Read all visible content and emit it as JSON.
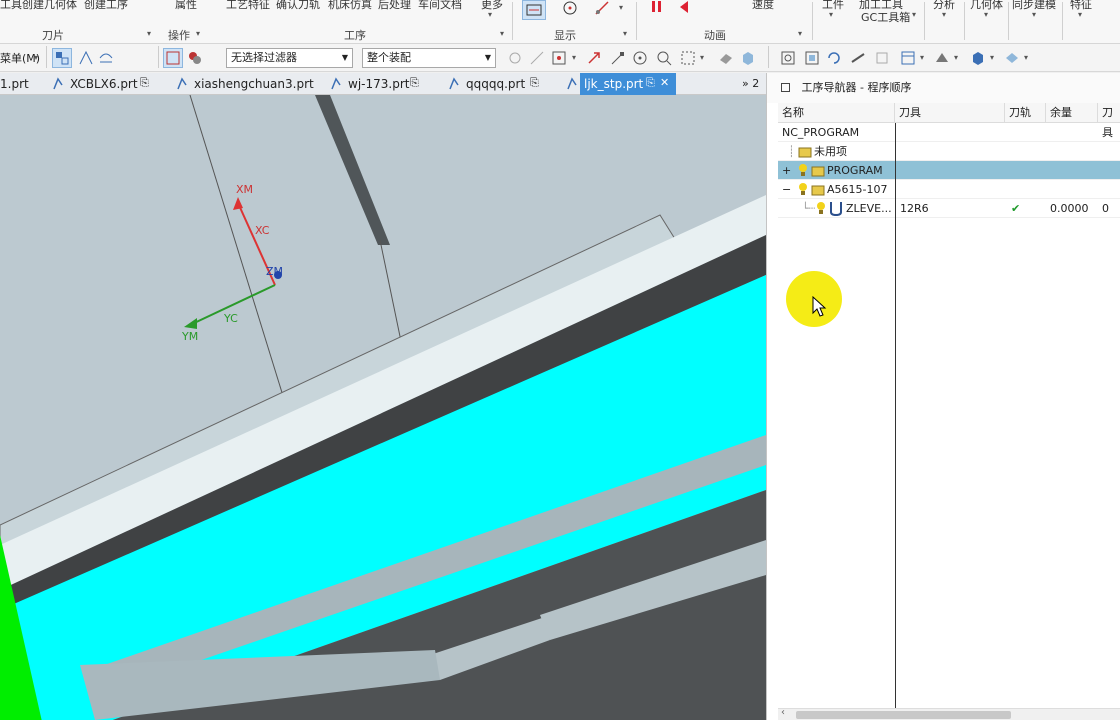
{
  "ribbon": {
    "top_items": [
      "工具",
      "创建几何体",
      "创建工序",
      "属性",
      "工艺特征",
      "确认刀轨",
      "机床仿真",
      "后处理",
      "车间文档",
      "更多",
      "速度",
      "工件",
      "加工工具",
      "GC工具箱",
      "分析",
      "几何体",
      "同步建模",
      "特征"
    ],
    "groups": [
      "刀片",
      "操作",
      "工序",
      "显示",
      "动画"
    ],
    "speed_label": "速度"
  },
  "toolbar": {
    "menu_label": "菜单(M)",
    "filter_value": "无选择过滤器",
    "assembly_value": "整个装配"
  },
  "tabs": {
    "items": [
      "1.prt",
      "XCBLX6.prt",
      "xiashengchuan3.prt",
      "wj-173.prt",
      "qqqqq.prt",
      "ljk_stp.prt"
    ],
    "overflow": "» 2",
    "close": "✕"
  },
  "viewport": {
    "axes": {
      "xm": "XM",
      "xc": "XC",
      "zm": "ZM",
      "yc": "YC",
      "ym": "YM"
    },
    "colors": {
      "background": "#bcc9d0",
      "highlight_face": "#00ffff",
      "dark_face": "#4f5254",
      "green_face": "#00ee00"
    }
  },
  "navigator": {
    "title": "工序导航器 - 程序顺序",
    "columns": [
      "名称",
      "刀具",
      "刀轨",
      "余量",
      "刀具"
    ],
    "rows": [
      {
        "name": "NC_PROGRAM",
        "tool": "",
        "path": "",
        "stock": "",
        "extra": ""
      },
      {
        "name": "未用项",
        "tool": "",
        "path": "",
        "stock": "",
        "extra": ""
      },
      {
        "name": "PROGRAM",
        "tool": "",
        "path": "",
        "stock": "",
        "extra": ""
      },
      {
        "name": "A5615-107",
        "tool": "",
        "path": "",
        "stock": "",
        "extra": ""
      },
      {
        "name": "ZLEVE...",
        "tool": "12R6",
        "path": "✔",
        "stock": "0.0000",
        "extra": "0"
      }
    ],
    "expanders": [
      "+",
      "−"
    ]
  }
}
